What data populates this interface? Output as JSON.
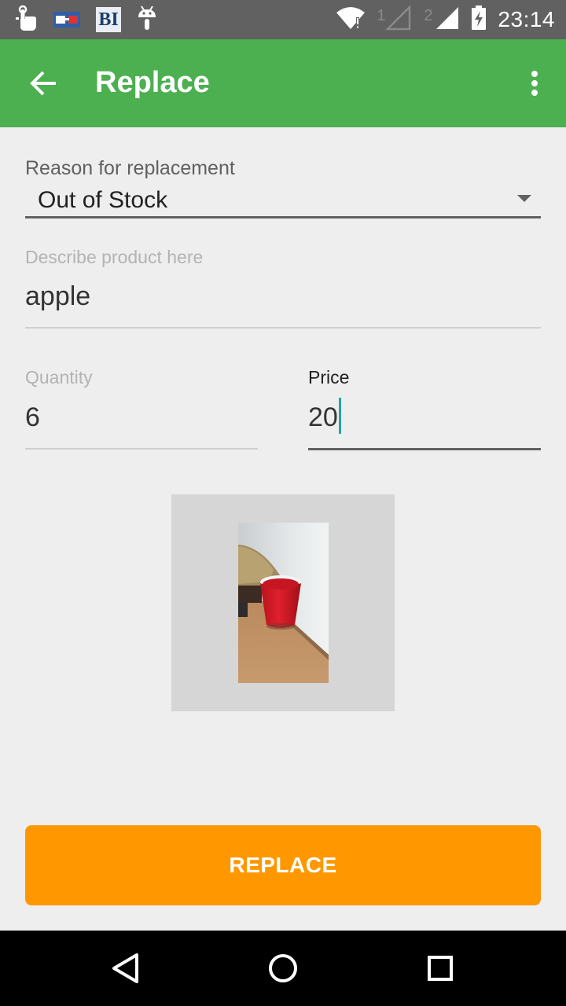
{
  "status_bar": {
    "left_icons": [
      "touch-icon",
      "glasses-icon",
      "bi-icon",
      "android-icon"
    ],
    "bi_text": "BI",
    "sim1_label": "1",
    "sim2_label": "2",
    "time": "23:14",
    "right_icons": [
      "wifi-icon",
      "signal-sim1-icon",
      "signal-sim2-icon",
      "battery-charging-icon"
    ]
  },
  "app_bar": {
    "title": "Replace",
    "back_icon": "arrow-left-icon",
    "menu_icon": "more-vert-icon",
    "color": "#4caf50"
  },
  "form": {
    "reason_label": "Reason for replacement",
    "reason_value": "Out of Stock",
    "describe_placeholder": "Describe product here",
    "describe_value": "apple",
    "quantity_label": "Quantity",
    "quantity_value": "6",
    "price_label": "Price",
    "price_value": "20",
    "cursor_color": "#26a69a"
  },
  "photo": {
    "description_icon": "product-photo"
  },
  "actions": {
    "replace_label": "REPLACE",
    "replace_color": "#ff9800"
  },
  "nav_bar": {
    "icons": [
      "back-triangle-icon",
      "home-circle-icon",
      "recents-square-icon"
    ]
  }
}
